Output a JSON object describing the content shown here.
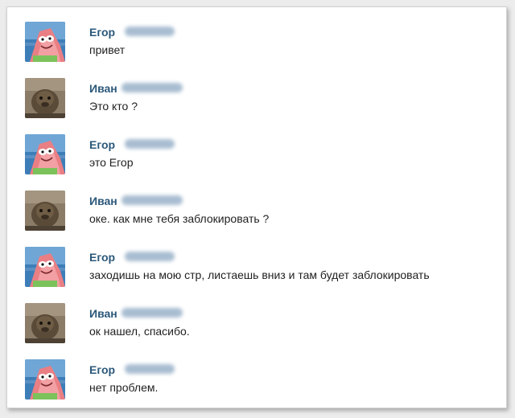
{
  "messages": [
    {
      "sender": "Егор",
      "avatar": "patrick-star-icon",
      "text": "привет"
    },
    {
      "sender": "Иван",
      "avatar": "animal-photo-icon",
      "text": "Это кто ?"
    },
    {
      "sender": "Егор",
      "avatar": "patrick-star-icon",
      "text": "это Егор"
    },
    {
      "sender": "Иван",
      "avatar": "animal-photo-icon",
      "text": "оке. как мне тебя заблокировать ?"
    },
    {
      "sender": "Егор",
      "avatar": "patrick-star-icon",
      "text": "заходишь на мою стр, листаешь вниз и там будет заблокировать"
    },
    {
      "sender": "Иван",
      "avatar": "animal-photo-icon",
      "text": "ок нашел, спасибо."
    },
    {
      "sender": "Егор",
      "avatar": "patrick-star-icon",
      "text": "нет проблем."
    }
  ],
  "colors": {
    "name": "#2b587a",
    "text": "#1f1f1f",
    "background": "#ffffff"
  }
}
